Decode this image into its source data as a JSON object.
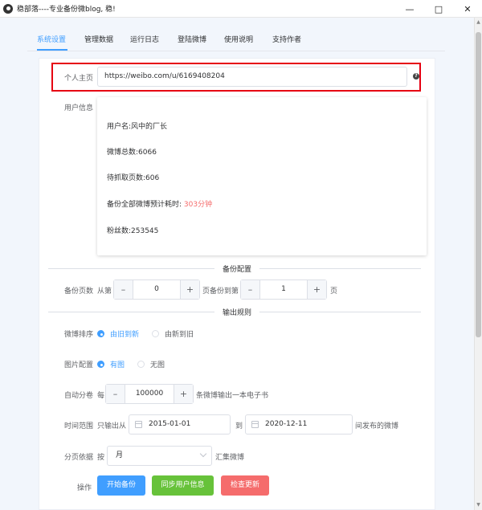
{
  "window": {
    "title": "稳部落----专业备份微blog, 稳!"
  },
  "tabs": [
    {
      "label": "系统设置",
      "active": true
    },
    {
      "label": "管理数据",
      "active": false
    },
    {
      "label": "运行日志",
      "active": false
    },
    {
      "label": "登陆微博",
      "active": false
    },
    {
      "label": "使用说明",
      "active": false
    },
    {
      "label": "支持作者",
      "active": false
    }
  ],
  "profile": {
    "label": "个人主页",
    "url": "https://weibo.com/u/6169408204"
  },
  "user_info": {
    "label": "用户信息",
    "username": "用户名:风中的厂长",
    "weibo_count": "微博总数:6066",
    "pages_to_fetch": "待抓取页数:606",
    "estimate_prefix": "备份全部微博预计耗时: ",
    "estimate_value": "303分钟",
    "followers": "粉丝数:253545"
  },
  "backup_config": {
    "title": "备份配置",
    "label": "备份页数",
    "from_label": "从第",
    "from_value": "0",
    "to_label": "页备份到第",
    "to_value": "1",
    "unit": "页"
  },
  "output_rules": {
    "title": "输出规则",
    "sort": {
      "label": "微博排序",
      "options": [
        "由旧到新",
        "由新到旧"
      ],
      "selected": "由旧到新"
    },
    "images": {
      "label": "图片配置",
      "options": [
        "有图",
        "无图"
      ],
      "selected": "有图"
    },
    "volume": {
      "label": "自动分卷",
      "prefix": "每",
      "value": "100000",
      "suffix": "条微博输出一本电子书"
    },
    "time_range": {
      "label": "时间范围",
      "prefix": "只输出从",
      "start": "2015-01-01",
      "to": "到",
      "end": "2020-12-11",
      "suffix": "间发布的微博"
    },
    "paging": {
      "label": "分页依据",
      "prefix": "按",
      "selected": "月",
      "suffix": "汇集微博"
    }
  },
  "actions": {
    "label": "操作",
    "start": "开始备份",
    "sync": "同步用户信息",
    "update": "检查更新"
  },
  "colors": {
    "primary": "#409eff",
    "success": "#67c23a",
    "danger": "#f56c6c",
    "highlight": "#e60012"
  }
}
